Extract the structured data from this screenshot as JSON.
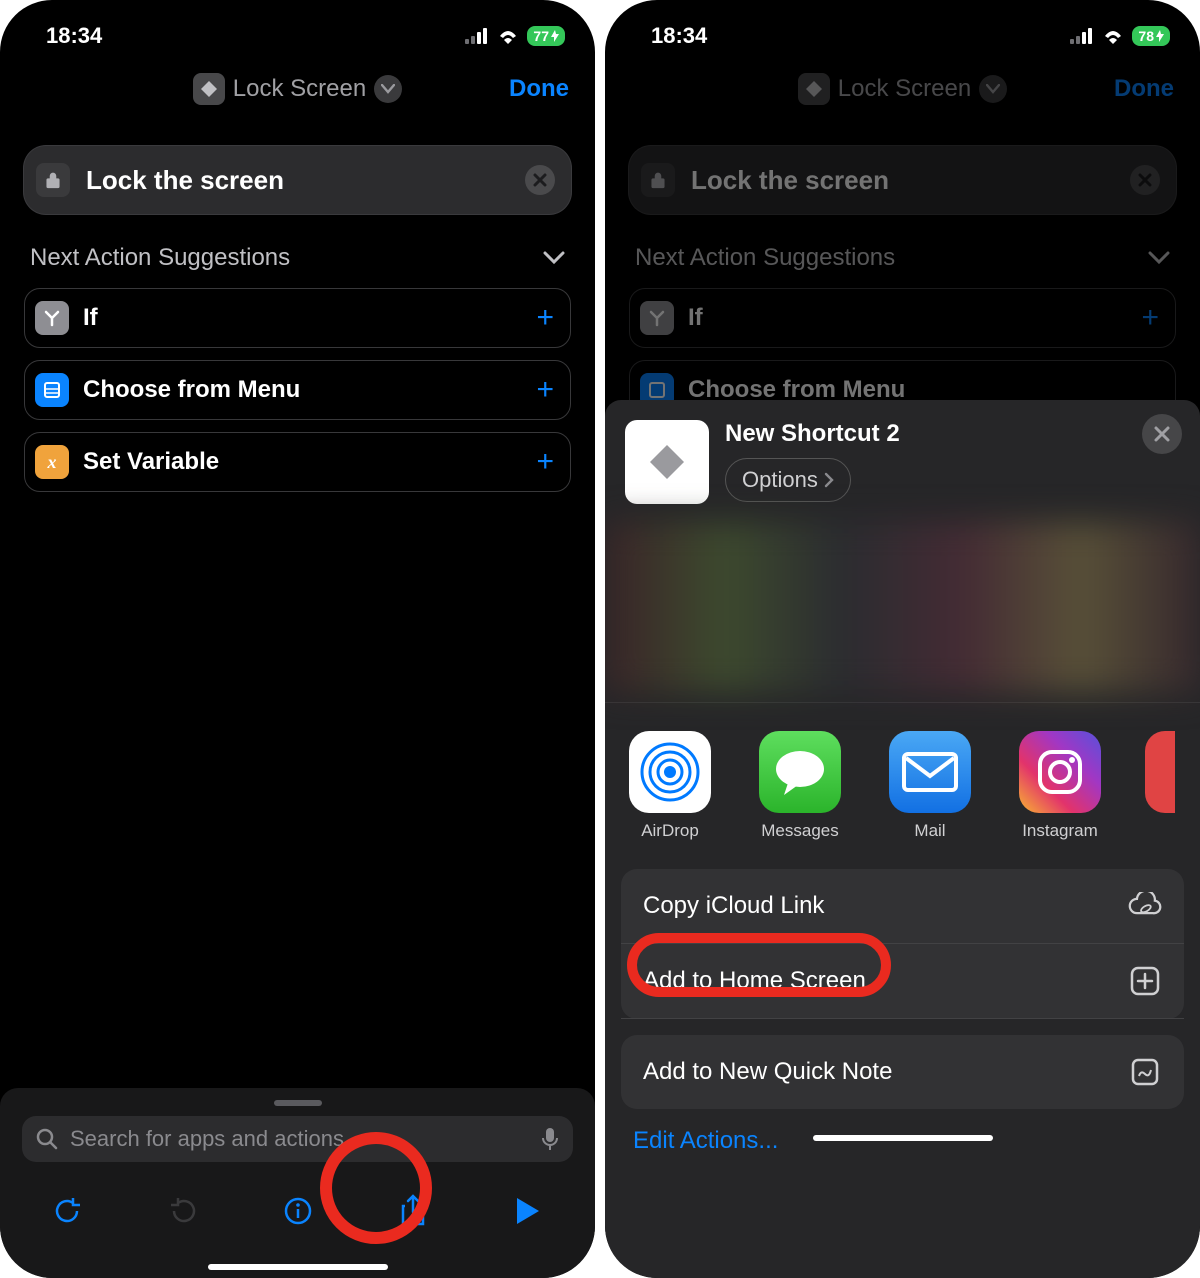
{
  "left": {
    "status": {
      "time": "18:34",
      "battery": "77"
    },
    "nav": {
      "title": "Lock Screen",
      "done": "Done"
    },
    "action": {
      "title": "Lock the screen"
    },
    "section_title": "Next Action Suggestions",
    "suggestions": [
      {
        "label": "If",
        "icon_color": "#8e8e93",
        "icon_text": "Y"
      },
      {
        "label": "Choose from Menu",
        "icon_color": "#0a84ff",
        "icon_text": "≡"
      },
      {
        "label": "Set Variable",
        "icon_color": "#f0a33c",
        "icon_text": "x"
      }
    ],
    "search_placeholder": "Search for apps and actions",
    "toolbar": {
      "undo": "undo",
      "redo": "redo",
      "info": "info",
      "share": "share",
      "play": "play"
    }
  },
  "right": {
    "status": {
      "time": "18:34",
      "battery": "78"
    },
    "nav": {
      "title": "Lock Screen",
      "done": "Done"
    },
    "action": {
      "title": "Lock the screen"
    },
    "section_title": "Next Action Suggestions",
    "suggestions": [
      {
        "label": "If"
      },
      {
        "label": "Choose from Menu"
      }
    ],
    "sheet": {
      "title": "New Shortcut 2",
      "options": "Options",
      "apps": [
        {
          "label": "AirDrop"
        },
        {
          "label": "Messages"
        },
        {
          "label": "Mail"
        },
        {
          "label": "Instagram"
        }
      ],
      "actions": [
        {
          "label": "Copy iCloud Link",
          "icon": "cloud-link"
        },
        {
          "label": "Add to Home Screen",
          "icon": "plus-square"
        }
      ],
      "actions2": [
        {
          "label": "Add to New Quick Note",
          "icon": "quicknote"
        }
      ],
      "edit_actions": "Edit Actions..."
    }
  }
}
